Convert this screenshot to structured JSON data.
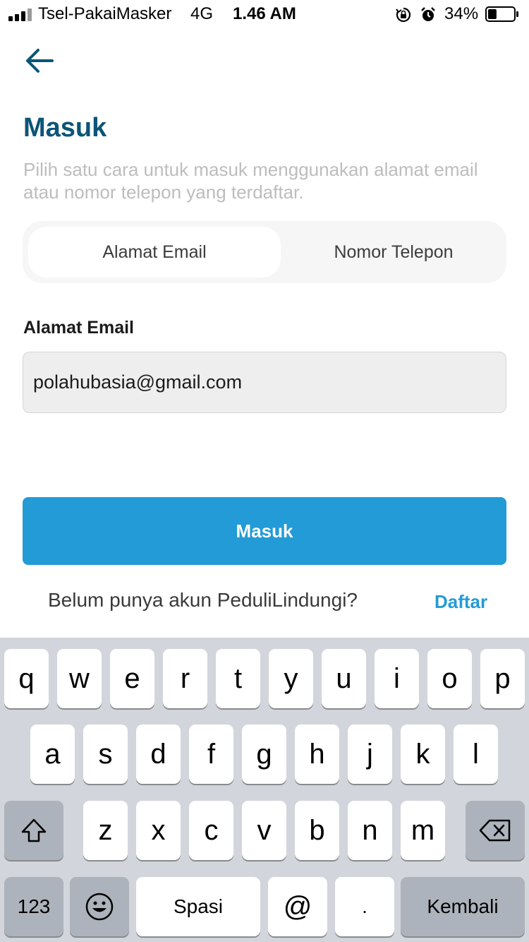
{
  "status_bar": {
    "carrier": "Tsel-PakaiMasker",
    "network": "4G",
    "time": "1.46 AM",
    "battery": "34%",
    "battery_level": 0.34
  },
  "header": {
    "back_icon": "arrow-left-icon",
    "title": "Masuk",
    "subtitle": "Pilih satu cara untuk masuk menggunakan alamat email atau nomor telepon yang terdaftar."
  },
  "tabs": {
    "email": "Alamat Email",
    "phone": "Nomor Telepon"
  },
  "form": {
    "email_label": "Alamat Email",
    "email_value": "polahubasia@gmail.com"
  },
  "actions": {
    "submit_label": "Masuk",
    "register_question": "Belum punya akun PeduliLindungi?",
    "register_link": "Daftar"
  },
  "keyboard": {
    "row1": [
      "q",
      "w",
      "e",
      "r",
      "t",
      "y",
      "u",
      "i",
      "o",
      "p"
    ],
    "row2": [
      "a",
      "s",
      "d",
      "f",
      "g",
      "h",
      "j",
      "k",
      "l"
    ],
    "row3": [
      "z",
      "x",
      "c",
      "v",
      "b",
      "n",
      "m"
    ],
    "numbers_key": "123",
    "space_key": "Spasi",
    "at_key": "@",
    "dot_key": ".",
    "return_key": "Kembali",
    "shift_icon": "shift-icon",
    "delete_icon": "backspace-icon",
    "emoji_icon": "emoji-icon"
  },
  "colors": {
    "title": "#0b5578",
    "accent": "#239bd6",
    "keyboard_bg": "#d2d5db"
  }
}
